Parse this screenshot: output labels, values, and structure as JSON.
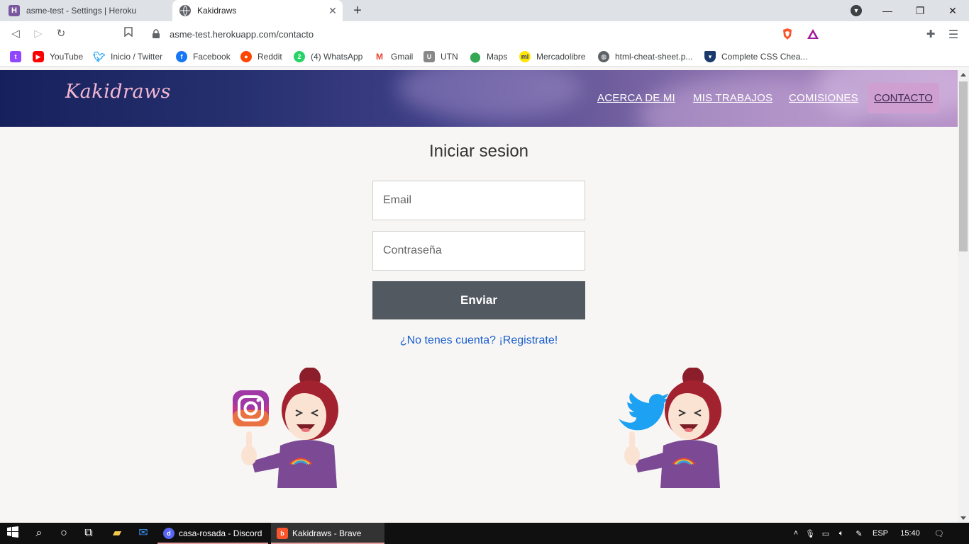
{
  "browser": {
    "tabs": [
      {
        "title": "asme-test - Settings | Heroku",
        "favicon_letter": "H",
        "favicon_color": "#79589f",
        "active": false
      },
      {
        "title": "Kakidraws",
        "favicon_letter": "",
        "favicon_color": "#5f6368",
        "active": true
      }
    ],
    "new_tab_glyph": "+",
    "address": "asme-test.herokuapp.com/contacto",
    "window_controls": [
      "minimize-icon",
      "restore-icon",
      "close-icon"
    ],
    "bookmarks": [
      {
        "label": "",
        "icon": "twitch-icon",
        "color": "#9146ff"
      },
      {
        "label": "YouTube",
        "icon": "youtube-icon",
        "color": "#ff0000"
      },
      {
        "label": "Inicio / Twitter",
        "icon": "twitter-icon",
        "color": "#1da1f2"
      },
      {
        "label": "Facebook",
        "icon": "facebook-icon",
        "color": "#1877f2"
      },
      {
        "label": "Reddit",
        "icon": "reddit-icon",
        "color": "#ff4500"
      },
      {
        "label": "(4) WhatsApp",
        "icon": "whatsapp-icon",
        "color": "#25d366"
      },
      {
        "label": "Gmail",
        "icon": "gmail-icon",
        "color": "#ea4335"
      },
      {
        "label": "UTN",
        "icon": "utn-icon",
        "color": "#6a6a6a"
      },
      {
        "label": "Maps",
        "icon": "maps-icon",
        "color": "#34a853"
      },
      {
        "label": "Mercadolibre",
        "icon": "mercadolibre-icon",
        "color": "#ffe600"
      },
      {
        "label": "html-cheat-sheet.p...",
        "icon": "globe-icon",
        "color": "#5f6368"
      },
      {
        "label": "Complete CSS Chea...",
        "icon": "shield-icon",
        "color": "#1b3a6b"
      }
    ]
  },
  "site": {
    "logo": "Kakidraws",
    "nav": [
      {
        "label": "ACERCA DE MI"
      },
      {
        "label": "MIS TRABAJOS"
      },
      {
        "label": "COMISIONES"
      },
      {
        "label": "CONTACTO",
        "active": true
      }
    ],
    "colors": {
      "header_start": "#16215c",
      "header_end": "#b792c8",
      "nav_active_bg": "#cf9fd2",
      "button_bg": "#535961",
      "link": "#1a5fcf"
    }
  },
  "login": {
    "title": "Iniciar sesion",
    "email_placeholder": "Email",
    "password_placeholder": "Contraseña",
    "submit_label": "Enviar",
    "register_link": "¿No tenes cuenta? ¡Registrate!"
  },
  "social": [
    {
      "network": "instagram",
      "icon": "instagram-icon"
    },
    {
      "network": "twitter",
      "icon": "twitter-icon"
    }
  ],
  "taskbar": {
    "apps": [
      {
        "label": "casa-rosada - Discord",
        "icon": "discord-icon",
        "color": "#5865f2"
      },
      {
        "label": "Kakidraws - Brave",
        "icon": "brave-icon",
        "color": "#fb542b",
        "active": true
      }
    ],
    "language": "ESP",
    "time": "15:40"
  }
}
